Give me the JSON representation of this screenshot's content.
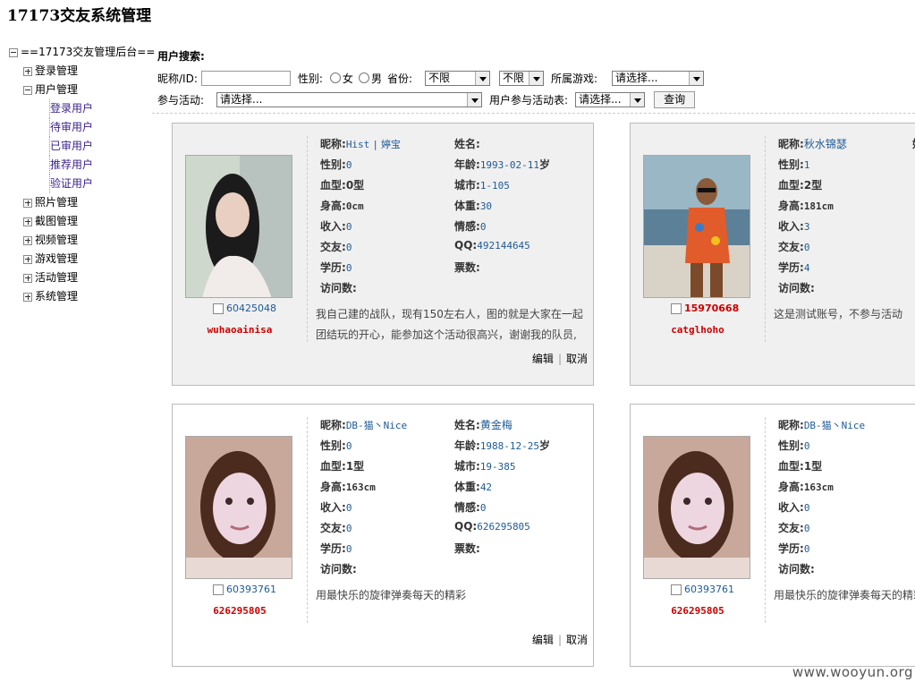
{
  "app_title": "17173交友系统管理",
  "tree": {
    "root": "==17173交友管理后台==",
    "items": [
      {
        "label": "登录管理",
        "expanded": false
      },
      {
        "label": "用户管理",
        "expanded": true,
        "children": [
          "登录用户",
          "待审用户",
          "已审用户",
          "推荐用户",
          "验证用户"
        ]
      },
      {
        "label": "照片管理",
        "expanded": false
      },
      {
        "label": "截图管理",
        "expanded": false
      },
      {
        "label": "视频管理",
        "expanded": false
      },
      {
        "label": "游戏管理",
        "expanded": false
      },
      {
        "label": "活动管理",
        "expanded": false
      },
      {
        "label": "系统管理",
        "expanded": false
      }
    ]
  },
  "search": {
    "title": "用户搜索:",
    "nickname_label": "昵称/ID:",
    "nickname_value": "",
    "gender_label": "性别:",
    "female": "女",
    "male": "男",
    "province_label": "省份:",
    "province_value": "不限",
    "city_value": "不限",
    "game_label": "所属游戏:",
    "game_value": "请选择...",
    "activity_label": "参与活动:",
    "activity_value": "请选择...",
    "activity_table_label": "用户参与活动表:",
    "activity_table_value": "请选择...",
    "query_button": "查询"
  },
  "field_labels": {
    "nickname": "昵称:",
    "name": "姓名:",
    "gender": "性别:",
    "age": "年龄:",
    "blood": "血型:",
    "city": "城市:",
    "height": "身高:",
    "weight": "体重:",
    "income": "收入:",
    "emotion": "情感:",
    "friends": "交友:",
    "qq": "QQ:",
    "education": "学历:",
    "tickets": "票数:",
    "visits": "访问数:"
  },
  "actions": {
    "edit": "编辑",
    "cancel": "取消"
  },
  "cards": [
    {
      "id": "60425048",
      "username": "wuhaoainisa",
      "nickname": "Hist",
      "nickname2": "婷宝",
      "name": "",
      "gender": "0",
      "age": "1993-02-11",
      "age_suffix": "岁",
      "blood": "0型",
      "city": "1-105",
      "height": "0cm",
      "weight": "30",
      "income": "0",
      "emotion": "0",
      "friends": "0",
      "qq": "492144645",
      "education": "0",
      "tickets": "",
      "visits": "",
      "desc": "我自己建的战队，现有150左右人，图的就是大家在一起团结玩的开心，能参加这个活动很高兴，谢谢我的队员,"
    },
    {
      "id": "15970668",
      "username": "catglhoho",
      "nickname": "秋水锦瑟",
      "name": "",
      "gender": "1",
      "blood": "2型",
      "height": "181cm",
      "income": "3",
      "friends": "0",
      "education": "4",
      "visits": "",
      "desc": "这是测试账号，不参与活动"
    },
    {
      "id": "60393761",
      "username": "626295805",
      "nickname": "DB-猫丶Nice",
      "name": "黄金梅",
      "gender": "0",
      "age": "1988-12-25",
      "age_suffix": "岁",
      "blood": "1型",
      "city": "19-385",
      "height": "163cm",
      "weight": "42",
      "income": "0",
      "emotion": "0",
      "friends": "0",
      "qq": "626295805",
      "education": "0",
      "tickets": "",
      "visits": "",
      "desc": "用最快乐的旋律弹奏每天的精彩"
    },
    {
      "id": "60393761",
      "username": "626295805",
      "nickname": "DB-猫丶Nice",
      "gender": "0",
      "blood": "1型",
      "height": "163cm",
      "income": "0",
      "friends": "0",
      "education": "0",
      "visits": "",
      "desc": "用最快乐的旋律弹奏每天的精彩"
    }
  ],
  "watermark": "www.wooyun.org"
}
